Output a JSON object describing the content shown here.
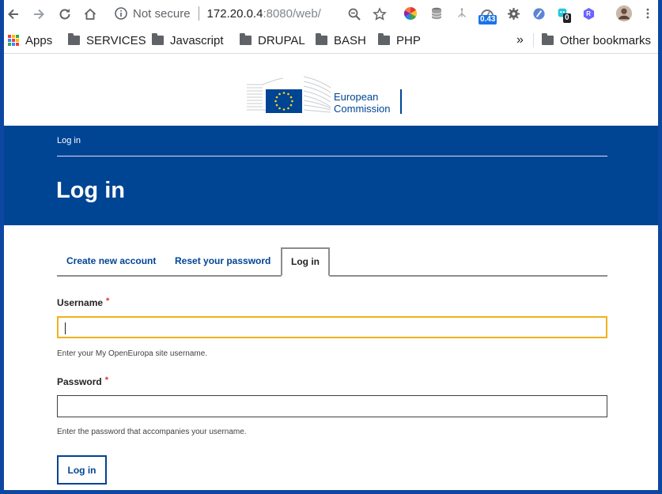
{
  "browser": {
    "security_label": "Not secure",
    "url_host": "172.20.0.4",
    "url_path": ":8080/web/",
    "extension_badge_1": "0.43",
    "extension_badge_2": "0",
    "extension_letter": "R"
  },
  "bookmarks": {
    "apps_label": "Apps",
    "items": [
      "SERVICES",
      "Javascript",
      "DRUPAL",
      "BASH",
      "PHP"
    ],
    "overflow": "»",
    "other": "Other bookmarks"
  },
  "logo": {
    "line1": "European",
    "line2": "Commission"
  },
  "header": {
    "breadcrumb": "Log in",
    "title": "Log in"
  },
  "tabs": [
    "Create new account",
    "Reset your password",
    "Log in"
  ],
  "form": {
    "username_label": "Username",
    "required_mark": "*",
    "username_help": "Enter your My OpenEuropa site username.",
    "password_label": "Password",
    "password_help": "Enter the password that accompanies your username.",
    "submit_label": "Log in"
  },
  "colors": {
    "brand_blue": "#004494",
    "focus_yellow": "#f2b01e",
    "required_red": "#dd3333"
  }
}
